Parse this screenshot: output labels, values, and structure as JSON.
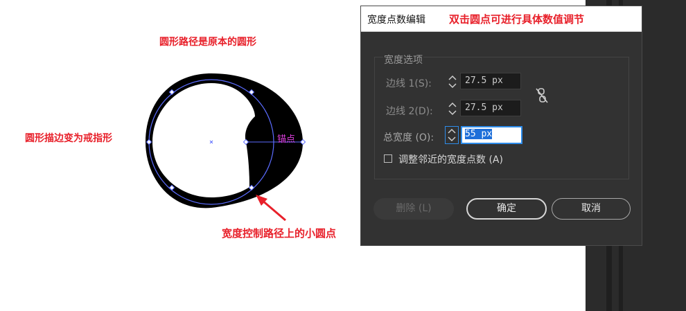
{
  "annotations": {
    "circle_path": "圆形路径是原本的圆形",
    "stroke_changed": "圆形描边变为戒指形",
    "anchor_point": "锚点",
    "width_points": "宽度控制路径上的小圆点",
    "double_click": "双击圆点可进行具体数值调节"
  },
  "dialog": {
    "title": "宽度点数编辑",
    "group_label": "宽度选项",
    "side1_label": "边线 1(S):",
    "side1_value": "27.5 px",
    "side2_label": "边线 2(D):",
    "side2_value": "27.5 px",
    "total_label": "总宽度 (O):",
    "total_value": "55 px",
    "adjust_label": "调整邻近的宽度点数 (A)",
    "adjust_checked": false,
    "delete_button": "删除 (L)",
    "ok_button": "确定",
    "cancel_button": "取消"
  },
  "icons": [
    "stepper-icon",
    "unlink-icon",
    "checkbox-icon",
    "arrow-icon",
    "anchor-point-icon",
    "center-mark-icon"
  ],
  "colors": {
    "annotation_red": "#e8202a",
    "anchor_magenta": "#e040e0",
    "path_blue": "#5b6cff",
    "dialog_bg": "#323232",
    "selection_blue": "#1e6fd9"
  }
}
